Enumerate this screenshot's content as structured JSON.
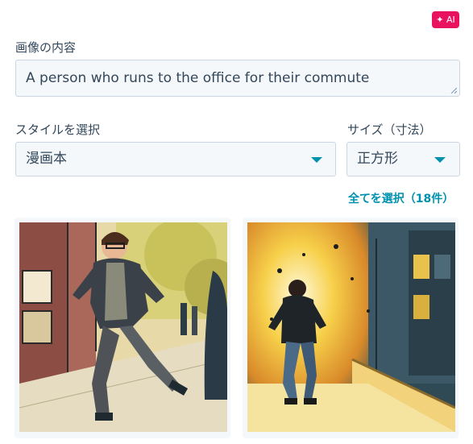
{
  "ai_badge": {
    "label": "✦ AI"
  },
  "prompt": {
    "label": "画像の内容",
    "value": "A person who runs to the office for their commute"
  },
  "style_select": {
    "label": "スタイルを選択",
    "value": "漫画本"
  },
  "size_select": {
    "label": "サイズ（寸法）",
    "value": "正方形"
  },
  "select_all": {
    "label": "全てを選択（18件）"
  },
  "colors": {
    "accent": "#0091ae",
    "ai_badge": "#e8125f",
    "field_bg": "#f5f8fa",
    "border": "#cbd6e2"
  },
  "images": [
    {
      "name": "comic-image-man-running-street"
    },
    {
      "name": "comic-image-man-running-explosion"
    }
  ]
}
